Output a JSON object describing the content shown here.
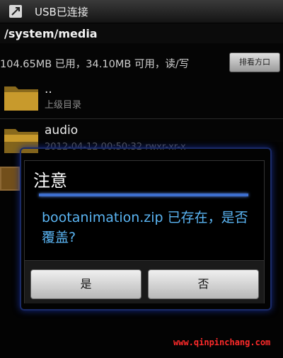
{
  "status_bar": {
    "icon": "usb-icon",
    "text": "USB已连接"
  },
  "path": "/system/media",
  "storage": {
    "summary": "104.65MB 已用，34.10MB 可用，读/写",
    "sort_button": "排看方口"
  },
  "files": [
    {
      "name": "..",
      "subtitle": "上级目录",
      "icon": "folder-icon"
    },
    {
      "name": "audio",
      "subtitle": "2012-04-12 00:50:32  rwxr-xr-x",
      "icon": "folder-icon"
    }
  ],
  "dialog": {
    "title": "注意",
    "message": "bootanimation.zip 已存在，是否覆盖?",
    "yes_label": "是",
    "no_label": "否"
  },
  "background_partial_text": "",
  "watermark": "www.qinpinchang.com",
  "colors": {
    "dialog_title_rule": "#3d6fd0",
    "dialog_message": "#5ab4f2",
    "watermark": "#ff2a2a",
    "folder": "#c89a2c"
  }
}
